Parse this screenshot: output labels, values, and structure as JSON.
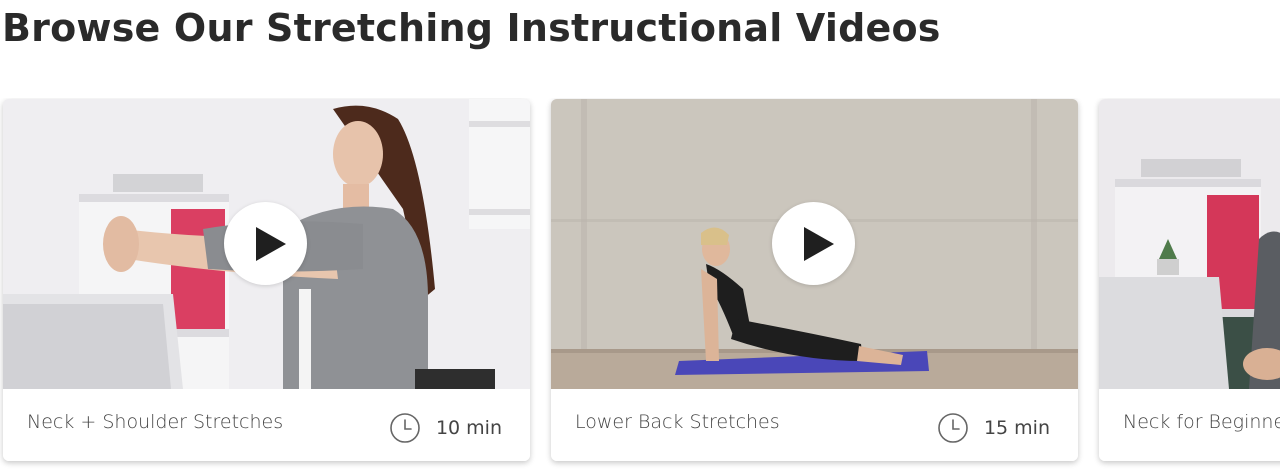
{
  "section": {
    "title": "Browse Our Stretching Instructional Videos"
  },
  "videos": [
    {
      "title": "Neck + Shoulder Stretches",
      "duration": "10 min",
      "thumbnail_icon": "woman-stretching-arms-at-desk"
    },
    {
      "title": "Lower Back Stretches",
      "duration": "15 min",
      "thumbnail_icon": "woman-cobra-pose-on-yoga-mat"
    },
    {
      "title": "Neck for Beginners",
      "duration": "",
      "thumbnail_icon": "man-at-desk-office"
    }
  ],
  "icons": {
    "play": "play-icon",
    "clock": "clock-icon"
  },
  "colors": {
    "title": "#2a2a2a",
    "text": "#444444",
    "mat": "#4a47b8"
  }
}
